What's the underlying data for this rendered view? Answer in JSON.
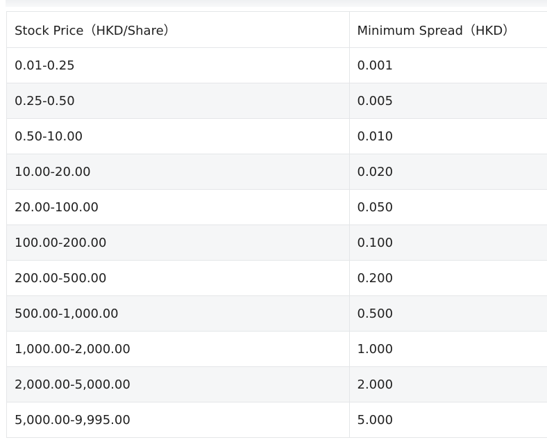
{
  "table": {
    "headers": [
      "Stock Price（HKD/Share）",
      "Minimum Spread（HKD）"
    ],
    "rows": [
      [
        "0.01-0.25",
        "0.001"
      ],
      [
        "0.25-0.50",
        "0.005"
      ],
      [
        "0.50-10.00",
        "0.010"
      ],
      [
        "10.00-20.00",
        "0.020"
      ],
      [
        "20.00-100.00",
        "0.050"
      ],
      [
        "100.00-200.00",
        "0.100"
      ],
      [
        "200.00-500.00",
        "0.200"
      ],
      [
        "500.00-1,000.00",
        "0.500"
      ],
      [
        "1,000.00-2,000.00",
        "1.000"
      ],
      [
        "2,000.00-5,000.00",
        "2.000"
      ],
      [
        "5,000.00-9,995.00",
        "5.000"
      ]
    ]
  }
}
